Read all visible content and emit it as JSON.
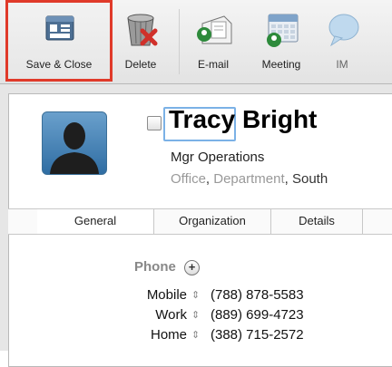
{
  "toolbar": {
    "buttons": [
      {
        "label": "Save & Close",
        "icon": "save-close-icon"
      },
      {
        "label": "Delete",
        "icon": "trash-icon"
      },
      {
        "label": "E-mail",
        "icon": "email-icon"
      },
      {
        "label": "Meeting",
        "icon": "calendar-icon"
      },
      {
        "label": "IM",
        "icon": "chat-bubble-icon"
      }
    ],
    "highlight_color": "#e03a2a"
  },
  "contact": {
    "first_name": "Tracy",
    "last_name": "Bright",
    "title": "Mgr Operations",
    "org_office": "Office",
    "org_department": "Department",
    "org_company": "South"
  },
  "tabs": [
    "General",
    "Organization",
    "Details"
  ],
  "phone": {
    "heading": "Phone",
    "rows": [
      {
        "label": "Mobile",
        "number": "(788) 878-5583"
      },
      {
        "label": "Work",
        "number": "(889) 699-4723"
      },
      {
        "label": "Home",
        "number": "(388) 715-2572"
      }
    ]
  }
}
